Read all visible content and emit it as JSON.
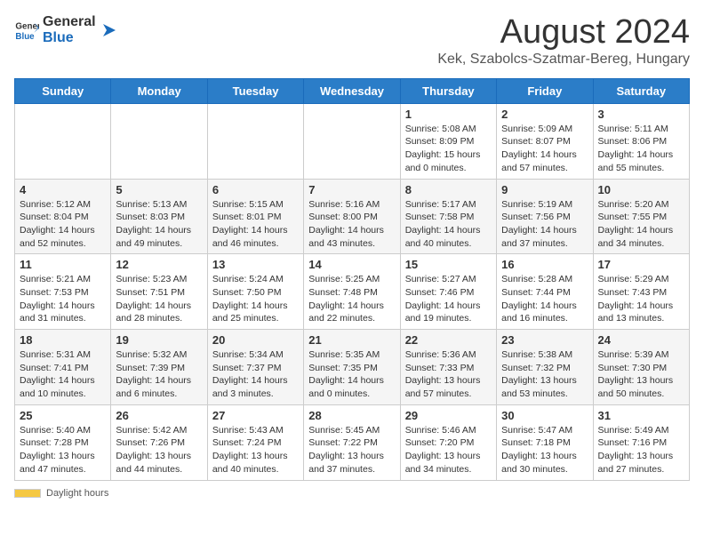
{
  "logo": {
    "general": "General",
    "blue": "Blue"
  },
  "title": "August 2024",
  "subtitle": "Kek, Szabolcs-Szatmar-Bereg, Hungary",
  "days_of_week": [
    "Sunday",
    "Monday",
    "Tuesday",
    "Wednesday",
    "Thursday",
    "Friday",
    "Saturday"
  ],
  "weeks": [
    [
      {
        "day": "",
        "info": ""
      },
      {
        "day": "",
        "info": ""
      },
      {
        "day": "",
        "info": ""
      },
      {
        "day": "",
        "info": ""
      },
      {
        "day": "1",
        "info": "Sunrise: 5:08 AM\nSunset: 8:09 PM\nDaylight: 15 hours\nand 0 minutes."
      },
      {
        "day": "2",
        "info": "Sunrise: 5:09 AM\nSunset: 8:07 PM\nDaylight: 14 hours\nand 57 minutes."
      },
      {
        "day": "3",
        "info": "Sunrise: 5:11 AM\nSunset: 8:06 PM\nDaylight: 14 hours\nand 55 minutes."
      }
    ],
    [
      {
        "day": "4",
        "info": "Sunrise: 5:12 AM\nSunset: 8:04 PM\nDaylight: 14 hours\nand 52 minutes."
      },
      {
        "day": "5",
        "info": "Sunrise: 5:13 AM\nSunset: 8:03 PM\nDaylight: 14 hours\nand 49 minutes."
      },
      {
        "day": "6",
        "info": "Sunrise: 5:15 AM\nSunset: 8:01 PM\nDaylight: 14 hours\nand 46 minutes."
      },
      {
        "day": "7",
        "info": "Sunrise: 5:16 AM\nSunset: 8:00 PM\nDaylight: 14 hours\nand 43 minutes."
      },
      {
        "day": "8",
        "info": "Sunrise: 5:17 AM\nSunset: 7:58 PM\nDaylight: 14 hours\nand 40 minutes."
      },
      {
        "day": "9",
        "info": "Sunrise: 5:19 AM\nSunset: 7:56 PM\nDaylight: 14 hours\nand 37 minutes."
      },
      {
        "day": "10",
        "info": "Sunrise: 5:20 AM\nSunset: 7:55 PM\nDaylight: 14 hours\nand 34 minutes."
      }
    ],
    [
      {
        "day": "11",
        "info": "Sunrise: 5:21 AM\nSunset: 7:53 PM\nDaylight: 14 hours\nand 31 minutes."
      },
      {
        "day": "12",
        "info": "Sunrise: 5:23 AM\nSunset: 7:51 PM\nDaylight: 14 hours\nand 28 minutes."
      },
      {
        "day": "13",
        "info": "Sunrise: 5:24 AM\nSunset: 7:50 PM\nDaylight: 14 hours\nand 25 minutes."
      },
      {
        "day": "14",
        "info": "Sunrise: 5:25 AM\nSunset: 7:48 PM\nDaylight: 14 hours\nand 22 minutes."
      },
      {
        "day": "15",
        "info": "Sunrise: 5:27 AM\nSunset: 7:46 PM\nDaylight: 14 hours\nand 19 minutes."
      },
      {
        "day": "16",
        "info": "Sunrise: 5:28 AM\nSunset: 7:44 PM\nDaylight: 14 hours\nand 16 minutes."
      },
      {
        "day": "17",
        "info": "Sunrise: 5:29 AM\nSunset: 7:43 PM\nDaylight: 14 hours\nand 13 minutes."
      }
    ],
    [
      {
        "day": "18",
        "info": "Sunrise: 5:31 AM\nSunset: 7:41 PM\nDaylight: 14 hours\nand 10 minutes."
      },
      {
        "day": "19",
        "info": "Sunrise: 5:32 AM\nSunset: 7:39 PM\nDaylight: 14 hours\nand 6 minutes."
      },
      {
        "day": "20",
        "info": "Sunrise: 5:34 AM\nSunset: 7:37 PM\nDaylight: 14 hours\nand 3 minutes."
      },
      {
        "day": "21",
        "info": "Sunrise: 5:35 AM\nSunset: 7:35 PM\nDaylight: 14 hours\nand 0 minutes."
      },
      {
        "day": "22",
        "info": "Sunrise: 5:36 AM\nSunset: 7:33 PM\nDaylight: 13 hours\nand 57 minutes."
      },
      {
        "day": "23",
        "info": "Sunrise: 5:38 AM\nSunset: 7:32 PM\nDaylight: 13 hours\nand 53 minutes."
      },
      {
        "day": "24",
        "info": "Sunrise: 5:39 AM\nSunset: 7:30 PM\nDaylight: 13 hours\nand 50 minutes."
      }
    ],
    [
      {
        "day": "25",
        "info": "Sunrise: 5:40 AM\nSunset: 7:28 PM\nDaylight: 13 hours\nand 47 minutes."
      },
      {
        "day": "26",
        "info": "Sunrise: 5:42 AM\nSunset: 7:26 PM\nDaylight: 13 hours\nand 44 minutes."
      },
      {
        "day": "27",
        "info": "Sunrise: 5:43 AM\nSunset: 7:24 PM\nDaylight: 13 hours\nand 40 minutes."
      },
      {
        "day": "28",
        "info": "Sunrise: 5:45 AM\nSunset: 7:22 PM\nDaylight: 13 hours\nand 37 minutes."
      },
      {
        "day": "29",
        "info": "Sunrise: 5:46 AM\nSunset: 7:20 PM\nDaylight: 13 hours\nand 34 minutes."
      },
      {
        "day": "30",
        "info": "Sunrise: 5:47 AM\nSunset: 7:18 PM\nDaylight: 13 hours\nand 30 minutes."
      },
      {
        "day": "31",
        "info": "Sunrise: 5:49 AM\nSunset: 7:16 PM\nDaylight: 13 hours\nand 27 minutes."
      }
    ]
  ],
  "footer": {
    "daylight_label": "Daylight hours"
  }
}
